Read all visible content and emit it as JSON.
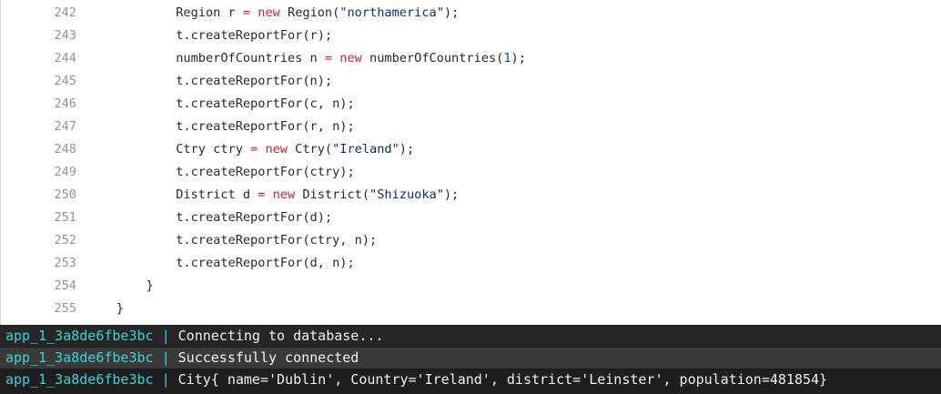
{
  "code": {
    "lines": [
      {
        "num": "242",
        "indent": "            ",
        "parts": [
          [
            "Region r ",
            ""
          ],
          [
            "=",
            ""
          ],
          [
            " ",
            ""
          ],
          [
            "new",
            "kw"
          ],
          [
            " Region(",
            ""
          ],
          [
            "\"northamerica\"",
            "str"
          ],
          [
            ");",
            ""
          ]
        ]
      },
      {
        "num": "243",
        "indent": "            ",
        "parts": [
          [
            "t.createReportFor(r);",
            ""
          ]
        ]
      },
      {
        "num": "244",
        "indent": "            ",
        "parts": [
          [
            "numberOfCountries n ",
            ""
          ],
          [
            "=",
            ""
          ],
          [
            " ",
            ""
          ],
          [
            "new",
            "kw"
          ],
          [
            " numberOfCountries(",
            ""
          ],
          [
            "1",
            "num"
          ],
          [
            ");",
            ""
          ]
        ]
      },
      {
        "num": "245",
        "indent": "            ",
        "parts": [
          [
            "t.createReportFor(n);",
            ""
          ]
        ]
      },
      {
        "num": "246",
        "indent": "            ",
        "parts": [
          [
            "t.createReportFor(c, n);",
            ""
          ]
        ]
      },
      {
        "num": "247",
        "indent": "            ",
        "parts": [
          [
            "t.createReportFor(r, n);",
            ""
          ]
        ]
      },
      {
        "num": "248",
        "indent": "            ",
        "parts": [
          [
            "Ctry ctry ",
            ""
          ],
          [
            "=",
            ""
          ],
          [
            " ",
            ""
          ],
          [
            "new",
            "kw"
          ],
          [
            " Ctry(",
            ""
          ],
          [
            "\"Ireland\"",
            "str"
          ],
          [
            ");",
            ""
          ]
        ]
      },
      {
        "num": "249",
        "indent": "            ",
        "parts": [
          [
            "t.createReportFor(ctry);",
            ""
          ]
        ]
      },
      {
        "num": "250",
        "indent": "            ",
        "parts": [
          [
            "District d ",
            ""
          ],
          [
            "=",
            ""
          ],
          [
            " ",
            ""
          ],
          [
            "new",
            "kw"
          ],
          [
            " District(",
            ""
          ],
          [
            "\"Shizuoka\"",
            "str"
          ],
          [
            ");",
            ""
          ]
        ]
      },
      {
        "num": "251",
        "indent": "            ",
        "parts": [
          [
            "t.createReportFor(d);",
            ""
          ]
        ]
      },
      {
        "num": "252",
        "indent": "            ",
        "parts": [
          [
            "t.createReportFor(ctry, n);",
            ""
          ]
        ]
      },
      {
        "num": "253",
        "indent": "            ",
        "parts": [
          [
            "t.createReportFor(d, n);",
            ""
          ]
        ]
      },
      {
        "num": "254",
        "indent": "        ",
        "parts": [
          [
            "}",
            ""
          ]
        ]
      },
      {
        "num": "255",
        "indent": "    ",
        "parts": [
          [
            "}",
            ""
          ]
        ]
      }
    ]
  },
  "terminal": {
    "lines": [
      {
        "service": "app_1_3a8de6fbe3bc",
        "separator": "|",
        "message": "Connecting to database..."
      },
      {
        "service": "app_1_3a8de6fbe3bc",
        "separator": "|",
        "message": "Successfully connected"
      },
      {
        "service": "app_1_3a8de6fbe3bc",
        "separator": "|",
        "message": "City{ name='Dublin', Country='Ireland', district='Leinster', population=481854}"
      }
    ]
  },
  "colors": {
    "keyword": "#cf222e",
    "string": "#0a3069",
    "number": "#0550ae",
    "terminal_bg": "#1e1e1e",
    "service_name": "#3cd3d6"
  }
}
